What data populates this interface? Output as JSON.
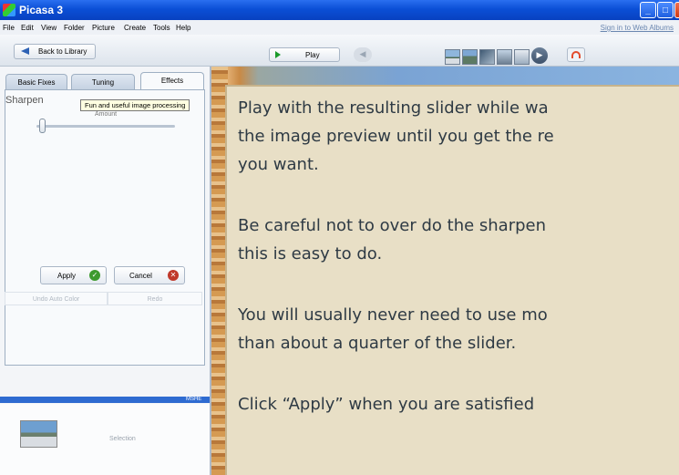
{
  "window": {
    "title": "Picasa 3",
    "minimize": "_",
    "maximize": "□",
    "close": "X"
  },
  "menu": {
    "items": [
      "File",
      "Edit",
      "View",
      "Folder",
      "Picture",
      "Create",
      "Tools",
      "Help"
    ],
    "signin": "Sign in to Web Albums"
  },
  "toolbar": {
    "back_label": "Back to Library",
    "play_label": "Play",
    "prev_icon": "left-arrow-icon",
    "next_icon": "right-arrow-icon",
    "share_icon": "share-icon"
  },
  "tabs": [
    "Basic Fixes",
    "Tuning",
    "Effects"
  ],
  "effect": {
    "name": "Sharpen",
    "tooltip": "Fun and useful image processing",
    "tooltip_sub": "Amount",
    "slider_value": 0.04
  },
  "buttons": {
    "apply": "Apply",
    "cancel": "Cancel",
    "undo": "Undo Auto Color",
    "redo": "Redo"
  },
  "panel": {
    "strip_label": "MSHE",
    "tray_label": "Selection"
  },
  "callout": {
    "p1_line1": "Play with the resulting slider while wa",
    "p1_line2": "the image preview until you get the re",
    "p1_line3": "you want.",
    "p2_line1": "Be careful not to over do the sharpen",
    "p2_line2": "this is easy to do.",
    "p3_line1": "You will usually never need to use mo",
    "p3_line2": "than about a quarter of the slider.",
    "p4_line1": "Click  “Apply”  when you are satisfied"
  },
  "colors": {
    "titlebar": "#0b4fd6",
    "callout_bg": "#e8dfc6",
    "accent": "#2e6bd1"
  }
}
